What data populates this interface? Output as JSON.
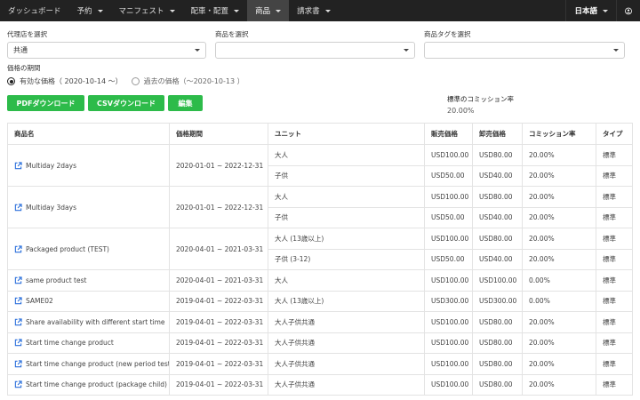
{
  "nav": {
    "left": [
      {
        "label": "ダッシュボード",
        "caret": false,
        "active": false
      },
      {
        "label": "予約",
        "caret": true,
        "active": false
      },
      {
        "label": "マニフェスト",
        "caret": true,
        "active": false
      },
      {
        "label": "配車・配置",
        "caret": true,
        "active": false
      },
      {
        "label": "商品",
        "caret": true,
        "active": true
      },
      {
        "label": "請求書",
        "caret": true,
        "active": false
      }
    ],
    "language": "日本語"
  },
  "filters": {
    "agency": {
      "label": "代理店を選択",
      "value": "共通"
    },
    "product": {
      "label": "商品を選択",
      "value": ""
    },
    "tag": {
      "label": "商品タグを選択",
      "value": ""
    }
  },
  "period": {
    "label": "価格の期間",
    "valid": "有効な価格（ 2020-10-14 〜）",
    "past": "過去の価格（〜2020-10-13 ）"
  },
  "buttons": {
    "pdf": "PDFダウンロード",
    "csv": "CSVダウンロード",
    "edit": "編集"
  },
  "commission": {
    "label": "標準のコミッション率",
    "value": "20.00%"
  },
  "colors": {
    "accent_green": "#2dbb4a",
    "nav_bg": "#222222",
    "link_blue": "#2a6fdb"
  },
  "table": {
    "headers": [
      "商品名",
      "価格期間",
      "ユニット",
      "販売価格",
      "卸売価格",
      "コミッション率",
      "タイプ"
    ],
    "products": [
      {
        "name": "Multiday 2days",
        "period": "2020-01-01 ~ 2022-12-31",
        "rows": [
          {
            "unit": "大人",
            "sale": "USD100.00",
            "wholesale": "USD80.00",
            "commission": "20.00%",
            "type": "標準"
          },
          {
            "unit": "子供",
            "sale": "USD50.00",
            "wholesale": "USD40.00",
            "commission": "20.00%",
            "type": "標準"
          }
        ]
      },
      {
        "name": "Multiday 3days",
        "period": "2020-01-01 ~ 2022-12-31",
        "rows": [
          {
            "unit": "大人",
            "sale": "USD100.00",
            "wholesale": "USD80.00",
            "commission": "20.00%",
            "type": "標準"
          },
          {
            "unit": "子供",
            "sale": "USD50.00",
            "wholesale": "USD40.00",
            "commission": "20.00%",
            "type": "標準"
          }
        ]
      },
      {
        "name": "Packaged product (TEST)",
        "period": "2020-04-01 ~ 2021-03-31",
        "rows": [
          {
            "unit": "大人 (13歳以上)",
            "sale": "USD100.00",
            "wholesale": "USD80.00",
            "commission": "20.00%",
            "type": "標準"
          },
          {
            "unit": "子供 (3-12)",
            "sale": "USD50.00",
            "wholesale": "USD40.00",
            "commission": "20.00%",
            "type": "標準"
          }
        ]
      },
      {
        "name": "same product test",
        "period": "2020-04-01 ~ 2021-03-31",
        "rows": [
          {
            "unit": "大人",
            "sale": "USD100.00",
            "wholesale": "USD100.00",
            "commission": "0.00%",
            "type": "標準"
          }
        ]
      },
      {
        "name": "SAME02",
        "period": "2019-04-01 ~ 2022-03-31",
        "rows": [
          {
            "unit": "大人 (13歳以上)",
            "sale": "USD300.00",
            "wholesale": "USD300.00",
            "commission": "0.00%",
            "type": "標準"
          }
        ]
      },
      {
        "name": "Share availability with different start time",
        "period": "2019-04-01 ~ 2022-03-31",
        "rows": [
          {
            "unit": "大人子供共通",
            "sale": "USD100.00",
            "wholesale": "USD80.00",
            "commission": "20.00%",
            "type": "標準"
          }
        ]
      },
      {
        "name": "Start time change product",
        "period": "2019-04-01 ~ 2022-03-31",
        "rows": [
          {
            "unit": "大人子供共通",
            "sale": "USD100.00",
            "wholesale": "USD80.00",
            "commission": "20.00%",
            "type": "標準"
          }
        ]
      },
      {
        "name": "Start time change product (new period test)",
        "period": "2019-04-01 ~ 2022-03-31",
        "rows": [
          {
            "unit": "大人子供共通",
            "sale": "USD100.00",
            "wholesale": "USD80.00",
            "commission": "20.00%",
            "type": "標準"
          }
        ]
      },
      {
        "name": "Start time change product (package child)",
        "period": "2019-04-01 ~ 2022-03-31",
        "rows": [
          {
            "unit": "大人子供共通",
            "sale": "USD100.00",
            "wholesale": "USD80.00",
            "commission": "20.00%",
            "type": "標準"
          }
        ]
      }
    ]
  }
}
